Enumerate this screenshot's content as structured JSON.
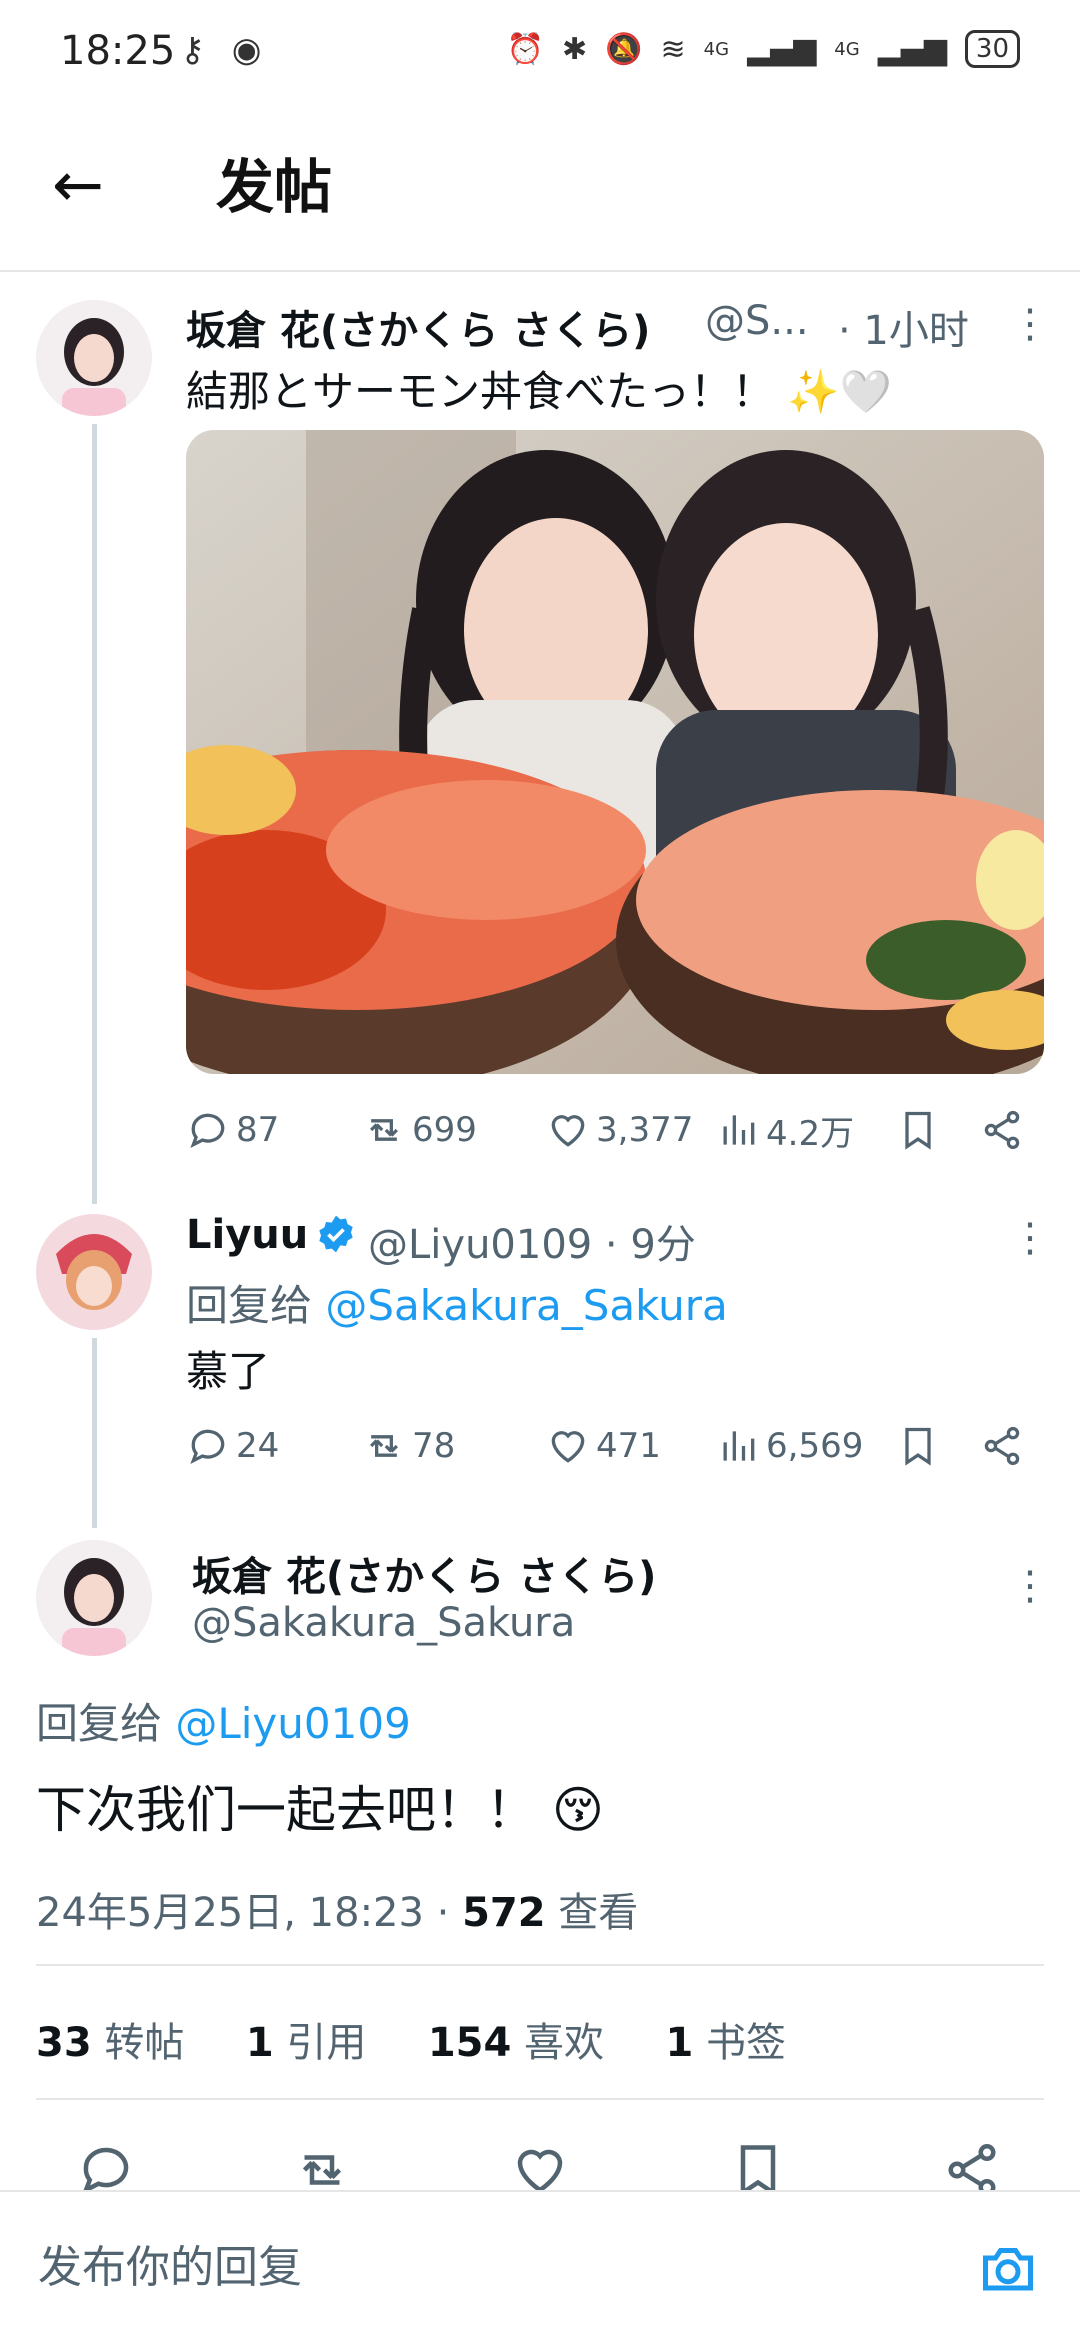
{
  "status_bar": {
    "time": "18:25",
    "battery": "30",
    "network": "4G"
  },
  "header": {
    "back_icon": "arrow-left-icon",
    "title": "发帖"
  },
  "tweet1": {
    "display_name": "坂倉 花(さかくら さくら)",
    "handle": "@S...",
    "time": "· 1小时",
    "text": "結那とサーモン丼食べたっ！！ ✨🤍",
    "replies": "87",
    "retweets": "699",
    "likes": "3,377",
    "views": "4.2万"
  },
  "tweet2": {
    "display_name": "Liyuu",
    "handle_time": "@Liyu0109 · 9分",
    "reply_prefix": "回复给 ",
    "reply_to": "@Sakakura_Sakura",
    "text": "慕了",
    "replies": "24",
    "retweets": "78",
    "likes": "471",
    "views": "6,569"
  },
  "main_tweet": {
    "display_name": "坂倉 花(さかくら さくら)",
    "handle": "@Sakakura_Sakura",
    "reply_prefix": "回复给 ",
    "reply_to": "@Liyu0109",
    "text": "下次我们一起去吧！！ 😚",
    "timestamp": "24年5月25日, 18:23 · ",
    "view_count": "572",
    "view_label": " 查看",
    "stats": {
      "retweets_num": "33",
      "retweets_label": "转帖",
      "quotes_num": "1",
      "quotes_label": "引用",
      "likes_num": "154",
      "likes_label": "喜欢",
      "bookmarks_num": "1",
      "bookmarks_label": "书签"
    }
  },
  "composer": {
    "placeholder": "发布你的回复",
    "camera_icon": "camera-icon"
  },
  "colors": {
    "accent": "#1d9bf0",
    "secondary_text": "#536471",
    "verified": "#1d9bf0"
  }
}
